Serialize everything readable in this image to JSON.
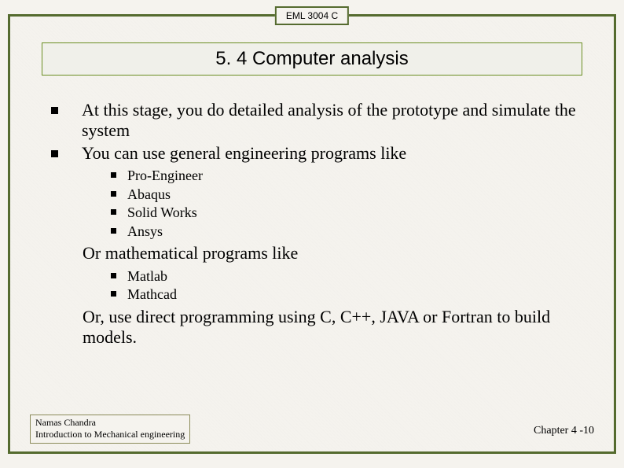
{
  "course_tag": "EML 3004 C",
  "title": "5. 4 Computer analysis",
  "bullets": {
    "b1": "At this stage, you do detailed analysis of the prototype and simulate the system",
    "b2": "You can use general engineering programs like"
  },
  "engineering_programs": {
    "p1": "Pro-Engineer",
    "p2": "Abaqus",
    "p3": "Solid Works",
    "p4": "Ansys"
  },
  "continuation1": "Or mathematical programs  like",
  "math_programs": {
    "m1": "Matlab",
    "m2": "Mathcad"
  },
  "continuation2": "Or, use direct programming using C, C++, JAVA or Fortran to build models.",
  "footer": {
    "author": "Namas Chandra",
    "subtitle": "Introduction to Mechanical engineering",
    "chapter": "Chapter 4 -10"
  }
}
